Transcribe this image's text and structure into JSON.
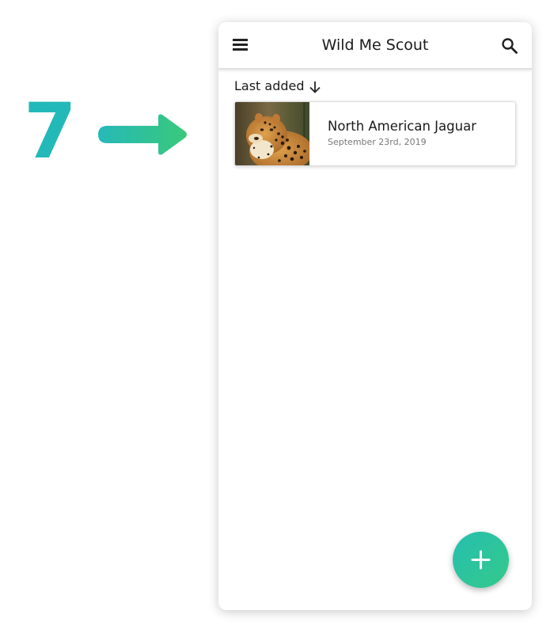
{
  "step": {
    "number": "7",
    "accent_color": "#23b9b9",
    "arrow_icon": "arrow-right-icon",
    "arrow_gradient": [
      "#26b9b9",
      "#39c97a"
    ]
  },
  "app": {
    "title": "Wild Me Scout",
    "menu_icon": "hamburger-menu-icon",
    "search_icon": "search-icon"
  },
  "sort": {
    "label": "Last added",
    "direction_icon": "arrow-down-icon"
  },
  "sightings": [
    {
      "title": "North American Jaguar",
      "date": "September 23rd, 2019",
      "thumbnail": "jaguar-photo"
    }
  ],
  "fab": {
    "icon": "plus-icon",
    "color": "#2fc4a0"
  }
}
